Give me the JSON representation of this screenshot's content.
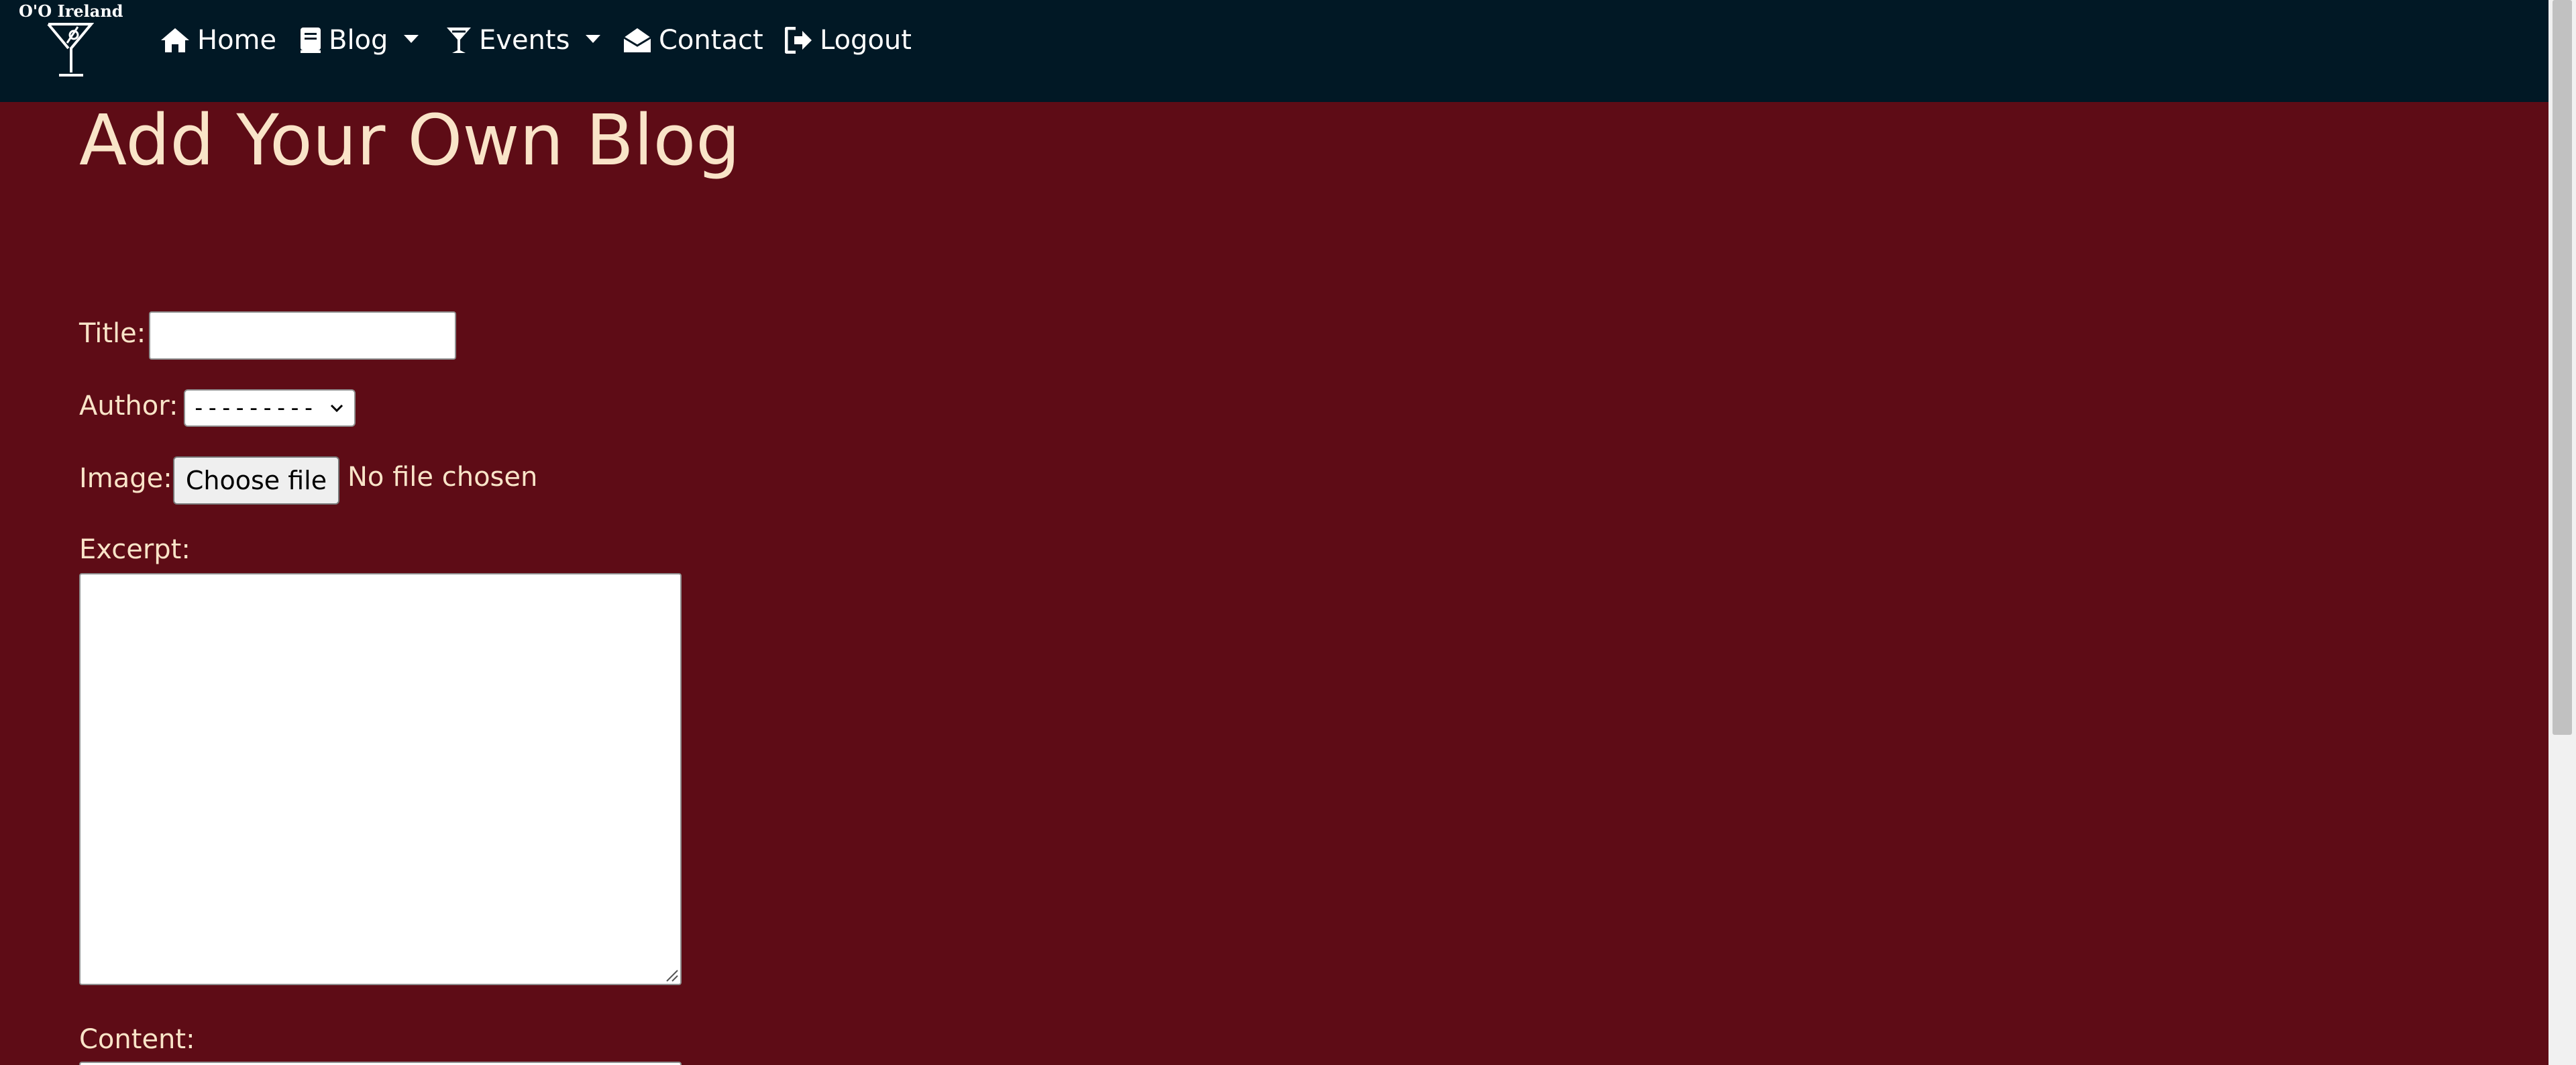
{
  "brand": {
    "name": "O'O Ireland"
  },
  "nav": {
    "items": [
      {
        "label": "Home",
        "icon": "home-icon"
      },
      {
        "label": "Blog",
        "icon": "book-icon",
        "dropdown": true
      },
      {
        "label": "Events",
        "icon": "cocktail-icon",
        "dropdown": true
      },
      {
        "label": "Contact",
        "icon": "envelope-open-icon"
      },
      {
        "label": "Logout",
        "icon": "sign-out-icon"
      }
    ]
  },
  "page": {
    "title": "Add Your Own Blog"
  },
  "form": {
    "title_label": "Title:",
    "title_value": "",
    "author_label": "Author:",
    "author_selected": "---------",
    "image_label": "Image:",
    "file_button_label": "Choose file",
    "file_status": "No file chosen",
    "excerpt_label": "Excerpt:",
    "excerpt_value": "",
    "content_label": "Content:"
  },
  "colors": {
    "navbar_bg": "#011825",
    "page_bg": "#5e0c16",
    "text_cream": "#f9e4c8",
    "nav_text": "#ffffff"
  }
}
